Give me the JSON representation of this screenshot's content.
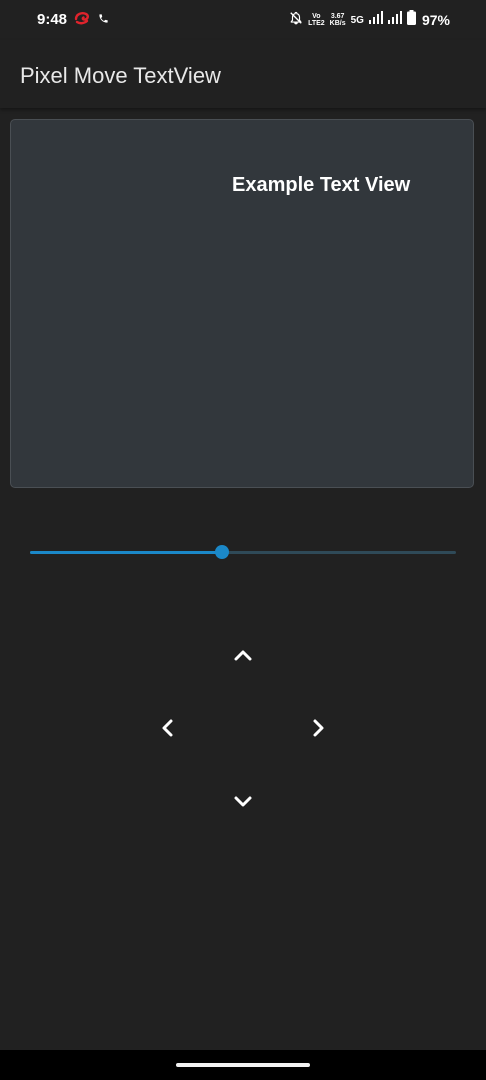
{
  "status_bar": {
    "time": "9:48",
    "volte_top": "Vo",
    "volte_bottom": "LTE2",
    "speed_value": "3.67",
    "speed_unit": "KB/s",
    "network": "5G",
    "battery": "97%",
    "icons": [
      "carrier-logo-icon",
      "phone-call-icon",
      "muted-bell-icon",
      "signal-icon",
      "signal-icon",
      "battery-icon"
    ]
  },
  "app_bar": {
    "title": "Pixel Move TextView"
  },
  "preview": {
    "text": "Example Text View"
  },
  "slider": {
    "value_fraction": 0.45
  },
  "controls": {
    "up_icon": "chevron-up-icon",
    "left_icon": "chevron-left-icon",
    "right_icon": "chevron-right-icon",
    "down_icon": "chevron-down-icon"
  },
  "colors": {
    "background": "#212121",
    "card": "#32373c",
    "accent": "#1b88c8",
    "track": "#2f4a58",
    "text": "#ffffff"
  }
}
